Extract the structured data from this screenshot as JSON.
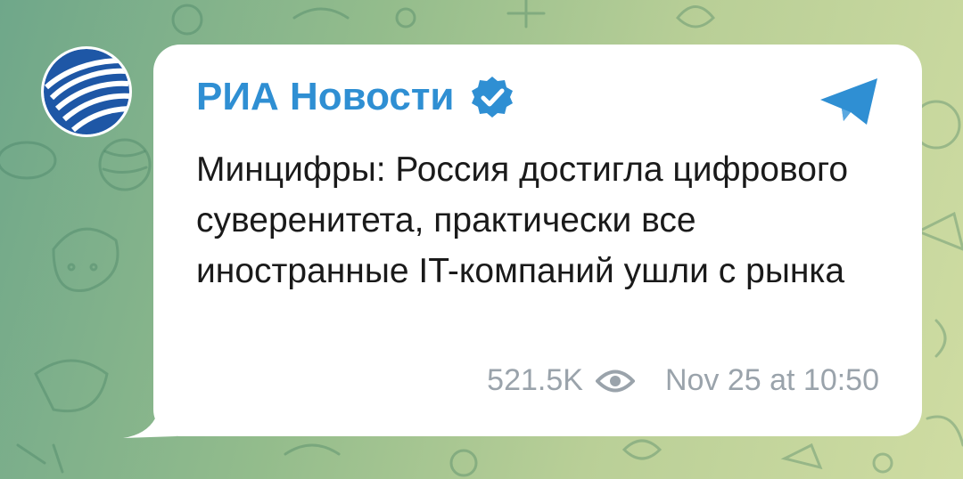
{
  "post": {
    "channel_name": "РИА Новости",
    "text": "Минцифры: Россия достигла цифрового суверенитета, практически все иностранные IT-компаний ушли с рынка",
    "views": "521.5K",
    "timestamp": "Nov 25 at 10:50"
  },
  "icons": {
    "avatar": "ria-logo",
    "verified": "verified-badge-icon",
    "share": "telegram-share-icon",
    "views": "eye-icon"
  },
  "colors": {
    "accent": "#2f8fd3",
    "avatar_blue": "#1e57a6",
    "meta_gray": "#9aa3ab",
    "bubble": "#ffffff"
  }
}
